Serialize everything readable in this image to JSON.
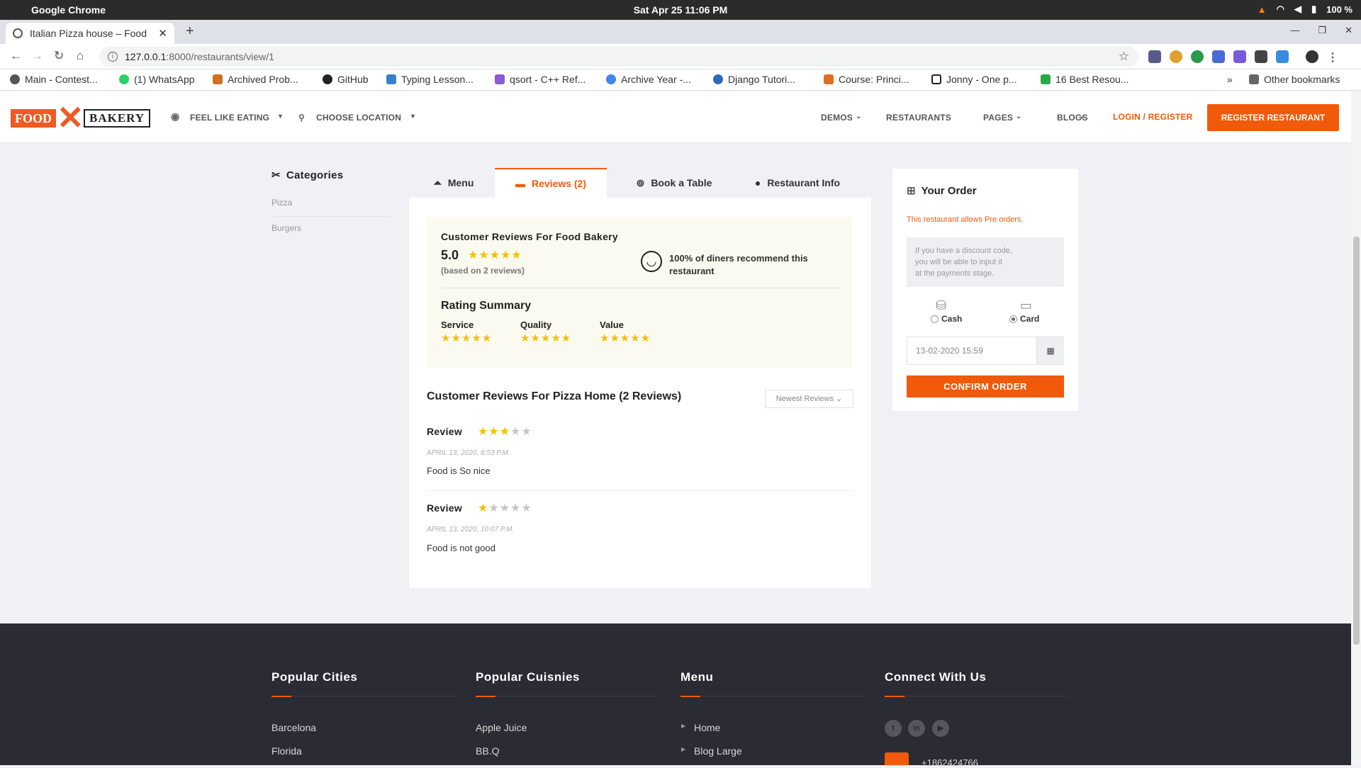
{
  "os": {
    "app_name": "Google Chrome",
    "clock": "Sat Apr 25  11:06 PM",
    "battery": "100 %"
  },
  "browser": {
    "tab_title": "Italian Pizza house – Food",
    "url_host": "127.0.0.1",
    "url_rest": ":8000/restaurants/view/1",
    "bookmarks": [
      "Main - Contest...",
      "(1) WhatsApp",
      "Archived Prob...",
      "GitHub",
      "Typing Lesson...",
      "qsort - C++ Ref...",
      "Archive Year -...",
      "Django Tutori...",
      "Course: Princi...",
      "Jonny - One p...",
      "16 Best Resou..."
    ],
    "bookmarks_more": "»",
    "other_bookmarks": "Other bookmarks"
  },
  "header": {
    "logo_food": "FOOD",
    "logo_bakery": "BAKERY",
    "feel_like_eating": "FEEL LIKE EATING",
    "choose_location": "CHOOSE LOCATION",
    "nav": [
      "DEMOS",
      "RESTAURANTS",
      "PAGES",
      "BLOGS"
    ],
    "login": "LOGIN / REGISTER",
    "register": "REGISTER RESTAURANT"
  },
  "categories": {
    "title": "Categories",
    "items": [
      "Pizza",
      "Burgers"
    ]
  },
  "tabs": [
    "Menu",
    "Reviews (2)",
    "Book a Table",
    "Restaurant Info"
  ],
  "summary": {
    "title": "Customer Reviews For Food Bakery",
    "score": "5.0",
    "based_on": "(based on 2 reviews)",
    "recommend_pct": "100%",
    "recommend_line1": " of diners recommend this",
    "recommend_line2": "restaurant",
    "rating_summary_title": "Rating Summary",
    "criteria": [
      {
        "label": "Service",
        "stars": 5
      },
      {
        "label": "Quality",
        "stars": 5
      },
      {
        "label": "Value",
        "stars": 5
      }
    ]
  },
  "reviews_section": {
    "title": "Customer Reviews For Pizza Home",
    "count": "(2 Reviews)",
    "sort": "Newest Reviews",
    "items": [
      {
        "label": "Review",
        "stars": 3,
        "date": "APRIL 13, 2020, 8:53 P.M.",
        "text": "Food is So nice"
      },
      {
        "label": "Review",
        "stars": 1,
        "date": "APRIL 13, 2020, 10:07 P.M.",
        "text": "Food is not good"
      }
    ]
  },
  "order": {
    "title": "Your Order",
    "preorder": "This restaurant allows Pre orders.",
    "discount_line1": "If you have a discount code,",
    "discount_line2": "you will be able to input it",
    "discount_line3": "at the payments stage.",
    "cash": "Cash",
    "card": "Card",
    "selected_payment": "Card",
    "datetime": "13-02-2020 15:59",
    "confirm": "CONFIRM ORDER"
  },
  "footer": {
    "columns": [
      {
        "title": "Popular Cities",
        "links": [
          "Barcelona",
          "Florida"
        ]
      },
      {
        "title": "Popular Cuisnies",
        "links": [
          "Apple Juice",
          "BB.Q"
        ]
      },
      {
        "title": "Menu",
        "links": [
          "Home",
          "Blog Large"
        ]
      },
      {
        "title": "Connect With Us",
        "links": []
      }
    ],
    "phone": "+1862424766"
  },
  "colors": {
    "accent": "#f05a0a",
    "star": "#f5c000",
    "footer_bg": "#2a2b33"
  }
}
